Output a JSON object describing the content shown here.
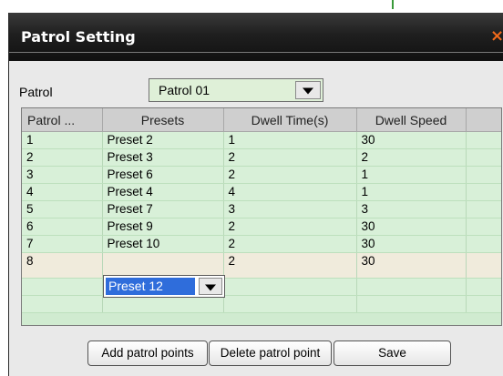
{
  "dialog": {
    "title": "Patrol Setting",
    "close_glyph": "×"
  },
  "patrol": {
    "label": "Patrol",
    "selected": "Patrol 01"
  },
  "table": {
    "columns": [
      "Patrol ...",
      "Presets",
      "Dwell Time(s)",
      "Dwell Speed"
    ],
    "rows": [
      {
        "num": "1",
        "preset": "Preset 2",
        "time": "1",
        "speed": "30"
      },
      {
        "num": "2",
        "preset": "Preset 3",
        "time": "2",
        "speed": "2"
      },
      {
        "num": "3",
        "preset": "Preset 6",
        "time": "2",
        "speed": "1"
      },
      {
        "num": "4",
        "preset": "Preset 4",
        "time": "4",
        "speed": "1"
      },
      {
        "num": "5",
        "preset": "Preset 7",
        "time": "3",
        "speed": "3"
      },
      {
        "num": "6",
        "preset": "Preset 9",
        "time": "2",
        "speed": "30"
      },
      {
        "num": "7",
        "preset": "Preset 10",
        "time": "2",
        "speed": "30"
      },
      {
        "num": "8",
        "preset": "Preset 12",
        "time": "2",
        "speed": "30"
      }
    ]
  },
  "buttons": {
    "add": "Add patrol points",
    "delete": "Delete patrol point",
    "save": "Save"
  },
  "icons": {
    "close": "close-icon",
    "dropdown": "chevron-down-icon"
  },
  "colors": {
    "title_bg": "#1f1f1f",
    "close": "#f26a1b",
    "row_bg": "#d8f0d8",
    "selected_row_bg": "#f0ebdc",
    "selection": "#2f6ddb"
  }
}
